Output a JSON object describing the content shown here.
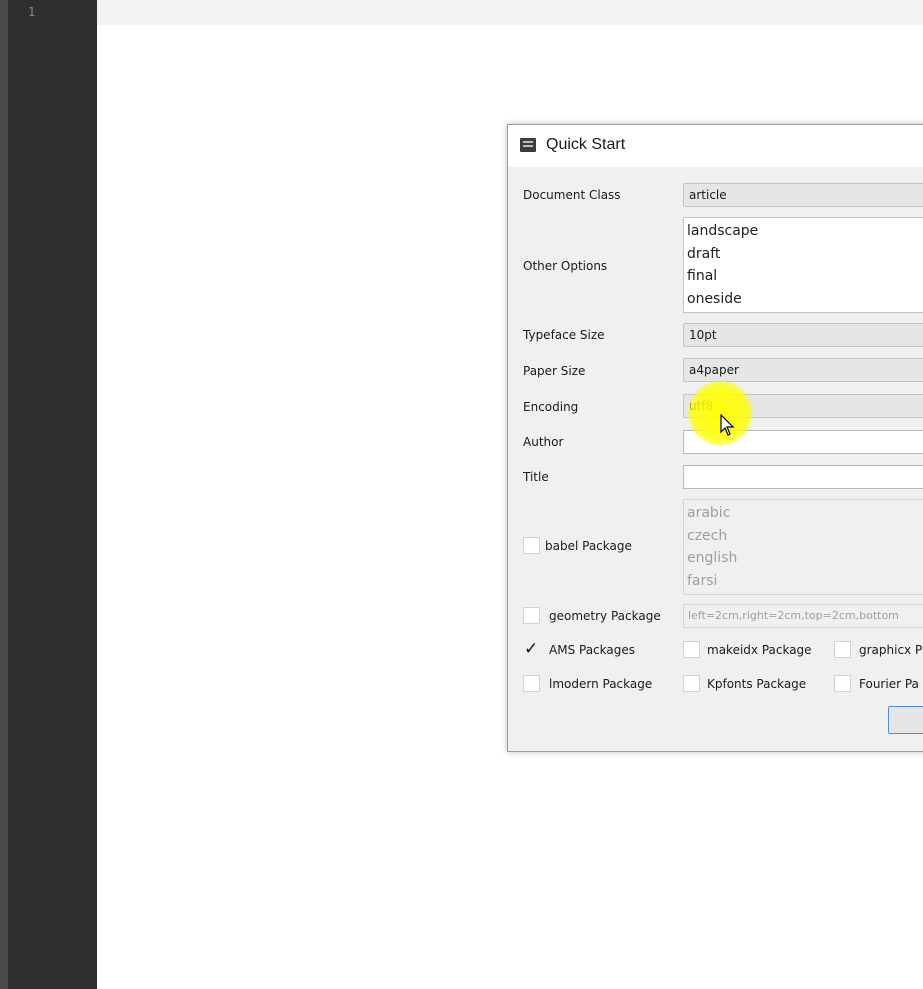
{
  "editor": {
    "line_numbers": [
      "1"
    ]
  },
  "dialog": {
    "title": "Quick Start",
    "document_class": {
      "label": "Document Class",
      "value": "article"
    },
    "other_options": {
      "label": "Other Options",
      "items": [
        "landscape",
        "draft",
        "final",
        "oneside"
      ]
    },
    "typeface_size": {
      "label": "Typeface Size",
      "value": "10pt"
    },
    "paper_size": {
      "label": "Paper Size",
      "value": "a4paper"
    },
    "encoding": {
      "label": "Encoding",
      "value": "utf8"
    },
    "author": {
      "label": "Author",
      "value": ""
    },
    "title_field": {
      "label": "Title",
      "value": ""
    },
    "babel": {
      "label": "babel Package",
      "checked": false,
      "languages": [
        "arabic",
        "czech",
        "english",
        "farsi"
      ]
    },
    "geometry": {
      "label": "geometry Package",
      "checked": false,
      "value": "left=2cm,right=2cm,top=2cm,bottom"
    },
    "packages": {
      "ams": {
        "label": "AMS Packages",
        "checked": true
      },
      "makeidx": {
        "label": "makeidx Package",
        "checked": false
      },
      "graphicx": {
        "label": "graphicx P",
        "checked": false
      },
      "lmodern": {
        "label": "lmodern Package",
        "checked": false
      },
      "kpfonts": {
        "label": "Kpfonts Package",
        "checked": false
      },
      "fourier": {
        "label": "Fourier Pa",
        "checked": false
      }
    },
    "checkmark_glyph": "✓",
    "cursor_icon": "mouse-pointer-icon"
  }
}
